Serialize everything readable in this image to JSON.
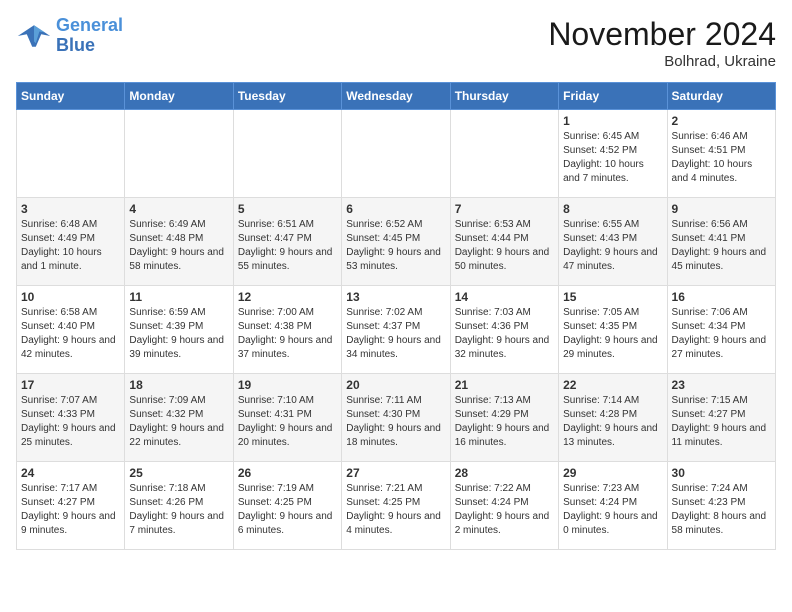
{
  "header": {
    "logo_line1": "General",
    "logo_line2": "Blue",
    "month": "November 2024",
    "location": "Bolhrad, Ukraine"
  },
  "weekdays": [
    "Sunday",
    "Monday",
    "Tuesday",
    "Wednesday",
    "Thursday",
    "Friday",
    "Saturday"
  ],
  "weeks": [
    [
      {
        "day": "",
        "info": ""
      },
      {
        "day": "",
        "info": ""
      },
      {
        "day": "",
        "info": ""
      },
      {
        "day": "",
        "info": ""
      },
      {
        "day": "",
        "info": ""
      },
      {
        "day": "1",
        "info": "Sunrise: 6:45 AM\nSunset: 4:52 PM\nDaylight: 10 hours and 7 minutes."
      },
      {
        "day": "2",
        "info": "Sunrise: 6:46 AM\nSunset: 4:51 PM\nDaylight: 10 hours and 4 minutes."
      }
    ],
    [
      {
        "day": "3",
        "info": "Sunrise: 6:48 AM\nSunset: 4:49 PM\nDaylight: 10 hours and 1 minute."
      },
      {
        "day": "4",
        "info": "Sunrise: 6:49 AM\nSunset: 4:48 PM\nDaylight: 9 hours and 58 minutes."
      },
      {
        "day": "5",
        "info": "Sunrise: 6:51 AM\nSunset: 4:47 PM\nDaylight: 9 hours and 55 minutes."
      },
      {
        "day": "6",
        "info": "Sunrise: 6:52 AM\nSunset: 4:45 PM\nDaylight: 9 hours and 53 minutes."
      },
      {
        "day": "7",
        "info": "Sunrise: 6:53 AM\nSunset: 4:44 PM\nDaylight: 9 hours and 50 minutes."
      },
      {
        "day": "8",
        "info": "Sunrise: 6:55 AM\nSunset: 4:43 PM\nDaylight: 9 hours and 47 minutes."
      },
      {
        "day": "9",
        "info": "Sunrise: 6:56 AM\nSunset: 4:41 PM\nDaylight: 9 hours and 45 minutes."
      }
    ],
    [
      {
        "day": "10",
        "info": "Sunrise: 6:58 AM\nSunset: 4:40 PM\nDaylight: 9 hours and 42 minutes."
      },
      {
        "day": "11",
        "info": "Sunrise: 6:59 AM\nSunset: 4:39 PM\nDaylight: 9 hours and 39 minutes."
      },
      {
        "day": "12",
        "info": "Sunrise: 7:00 AM\nSunset: 4:38 PM\nDaylight: 9 hours and 37 minutes."
      },
      {
        "day": "13",
        "info": "Sunrise: 7:02 AM\nSunset: 4:37 PM\nDaylight: 9 hours and 34 minutes."
      },
      {
        "day": "14",
        "info": "Sunrise: 7:03 AM\nSunset: 4:36 PM\nDaylight: 9 hours and 32 minutes."
      },
      {
        "day": "15",
        "info": "Sunrise: 7:05 AM\nSunset: 4:35 PM\nDaylight: 9 hours and 29 minutes."
      },
      {
        "day": "16",
        "info": "Sunrise: 7:06 AM\nSunset: 4:34 PM\nDaylight: 9 hours and 27 minutes."
      }
    ],
    [
      {
        "day": "17",
        "info": "Sunrise: 7:07 AM\nSunset: 4:33 PM\nDaylight: 9 hours and 25 minutes."
      },
      {
        "day": "18",
        "info": "Sunrise: 7:09 AM\nSunset: 4:32 PM\nDaylight: 9 hours and 22 minutes."
      },
      {
        "day": "19",
        "info": "Sunrise: 7:10 AM\nSunset: 4:31 PM\nDaylight: 9 hours and 20 minutes."
      },
      {
        "day": "20",
        "info": "Sunrise: 7:11 AM\nSunset: 4:30 PM\nDaylight: 9 hours and 18 minutes."
      },
      {
        "day": "21",
        "info": "Sunrise: 7:13 AM\nSunset: 4:29 PM\nDaylight: 9 hours and 16 minutes."
      },
      {
        "day": "22",
        "info": "Sunrise: 7:14 AM\nSunset: 4:28 PM\nDaylight: 9 hours and 13 minutes."
      },
      {
        "day": "23",
        "info": "Sunrise: 7:15 AM\nSunset: 4:27 PM\nDaylight: 9 hours and 11 minutes."
      }
    ],
    [
      {
        "day": "24",
        "info": "Sunrise: 7:17 AM\nSunset: 4:27 PM\nDaylight: 9 hours and 9 minutes."
      },
      {
        "day": "25",
        "info": "Sunrise: 7:18 AM\nSunset: 4:26 PM\nDaylight: 9 hours and 7 minutes."
      },
      {
        "day": "26",
        "info": "Sunrise: 7:19 AM\nSunset: 4:25 PM\nDaylight: 9 hours and 6 minutes."
      },
      {
        "day": "27",
        "info": "Sunrise: 7:21 AM\nSunset: 4:25 PM\nDaylight: 9 hours and 4 minutes."
      },
      {
        "day": "28",
        "info": "Sunrise: 7:22 AM\nSunset: 4:24 PM\nDaylight: 9 hours and 2 minutes."
      },
      {
        "day": "29",
        "info": "Sunrise: 7:23 AM\nSunset: 4:24 PM\nDaylight: 9 hours and 0 minutes."
      },
      {
        "day": "30",
        "info": "Sunrise: 7:24 AM\nSunset: 4:23 PM\nDaylight: 8 hours and 58 minutes."
      }
    ]
  ]
}
